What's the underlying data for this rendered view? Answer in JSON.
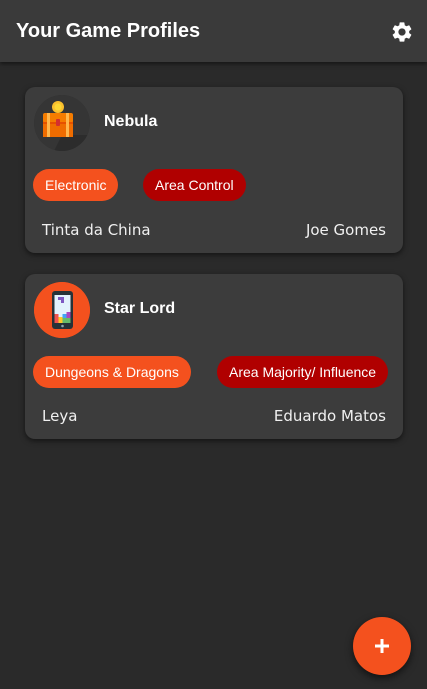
{
  "appbar": {
    "title": "Your Game Profiles",
    "settings_icon": "gear-icon"
  },
  "profiles": [
    {
      "name": "Nebula",
      "avatar_icon": "treasure-chest-icon",
      "tags": [
        {
          "label": "Electronic",
          "color": "#f4511e"
        },
        {
          "label": "Area Control",
          "color": "#b00000"
        }
      ],
      "publisher": "Tinta da China",
      "designer": "Joe Gomes"
    },
    {
      "name": "Star Lord",
      "avatar_icon": "tetris-phone-icon",
      "tags": [
        {
          "label": "Dungeons & Dragons",
          "color": "#f4511e"
        },
        {
          "label": "Area Majority/ Influence",
          "color": "#b00000"
        }
      ],
      "publisher": "Leya",
      "designer": "Eduardo Matos"
    }
  ],
  "fab": {
    "label": "+",
    "icon": "add-icon",
    "color": "#f4511e"
  }
}
